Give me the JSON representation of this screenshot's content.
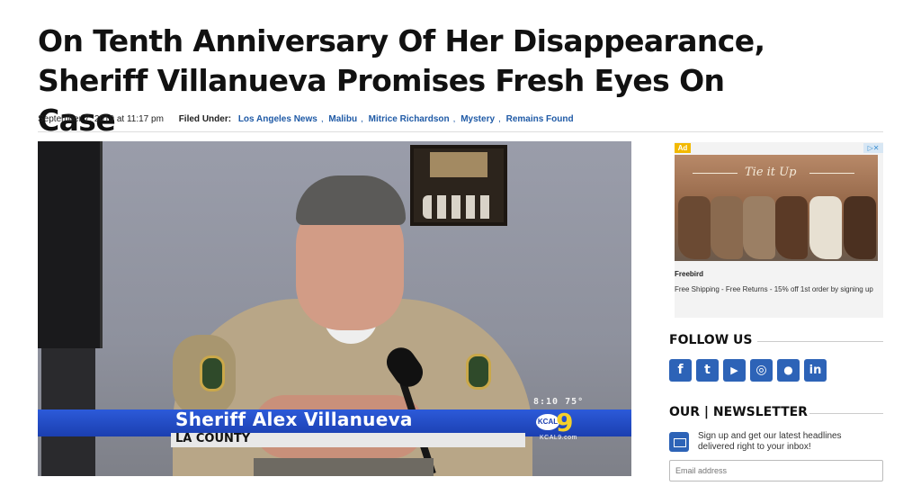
{
  "article": {
    "headline": "On Tenth Anniversary Of Her Disappearance, Sheriff Villanueva Promises Fresh Eyes On Case",
    "date": "September 7, 2019 at 11:17 pm",
    "filed_under_label": "Filed Under:",
    "tags": [
      "Los Angeles News",
      "Malibu",
      "Mitrice Richardson",
      "Mystery",
      "Remains Found"
    ]
  },
  "video": {
    "chyron_name": "Sheriff Alex Villanueva",
    "chyron_sub": "LA COUNTY",
    "clock": "8:10  75°",
    "station_logo": "KCAL",
    "station_number": "9",
    "station_url": "KCAL9.com"
  },
  "ad": {
    "badge": "Ad",
    "close": "▷✕",
    "image_script": "Tie it Up",
    "brand": "Freebird",
    "copy": "Free Shipping - Free Returns - 15% off 1st order by signing up"
  },
  "follow": {
    "title": "FOLLOW US",
    "icons": [
      {
        "name": "facebook-icon",
        "glyph": "f",
        "color": "#2d63b7"
      },
      {
        "name": "twitter-icon",
        "glyph": "t",
        "color": "#2d63b7"
      },
      {
        "name": "youtube-icon",
        "glyph": "▶",
        "color": "#2d63b7"
      },
      {
        "name": "instagram-icon",
        "glyph": "◎",
        "color": "#2d63b7"
      },
      {
        "name": "reddit-icon",
        "glyph": "●",
        "color": "#2d63b7"
      },
      {
        "name": "linkedin-icon",
        "glyph": "in",
        "color": "#2d63b7"
      }
    ]
  },
  "newsletter": {
    "title": "OUR | NEWSLETTER",
    "text": "Sign up and get our latest headlines delivered right to your inbox!",
    "placeholder": "Email address"
  }
}
